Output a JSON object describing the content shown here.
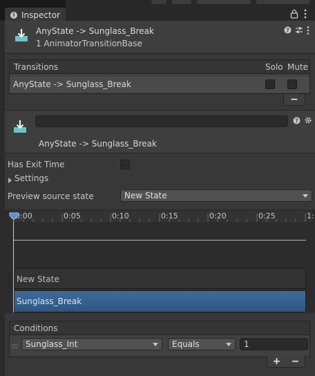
{
  "tab": {
    "title": "Inspector"
  },
  "header": {
    "title": "AnyState -> Sunglass_Break",
    "subtitle": "1 AnimatorTransitionBase"
  },
  "transitions": {
    "heading": "Transitions",
    "solo_label": "Solo",
    "mute_label": "Mute",
    "rows": [
      {
        "name": "AnyState -> Sunglass_Break"
      }
    ],
    "remove_label": "−"
  },
  "transition": {
    "name_field": "",
    "name": "AnyState -> Sunglass_Break"
  },
  "settings": {
    "has_exit_time_label": "Has Exit Time",
    "settings_label": "Settings",
    "preview_label": "Preview source state",
    "preview_value": "New State"
  },
  "timeline": {
    "ticks": [
      "0:00",
      "0:05",
      "0:10",
      "0:15",
      "0:20",
      "0:25",
      "1:"
    ],
    "source_state": "New State",
    "dest_state": "Sunglass_Break"
  },
  "conditions": {
    "heading": "Conditions",
    "parameter": "Sunglass_Int",
    "mode": "Equals",
    "threshold": "1",
    "add_label": "+",
    "remove_label": "−"
  },
  "colors": {
    "panel": "#383838",
    "accent_blue": "#3a6a9a",
    "icon_teal": "#6fc3c8"
  }
}
